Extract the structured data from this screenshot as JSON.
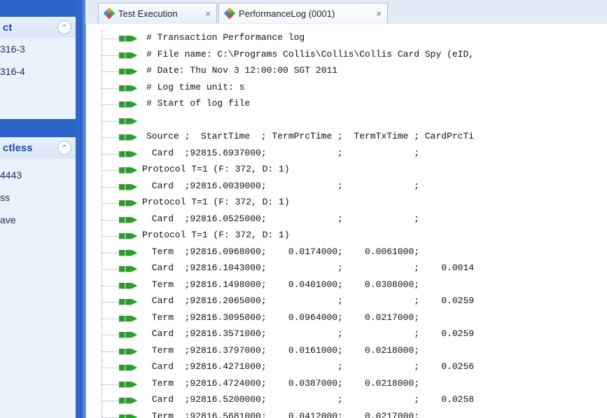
{
  "sidebar": {
    "panel1": {
      "title": "ct",
      "items": [
        "316-3",
        "316-4"
      ]
    },
    "panel2": {
      "title": "ctless",
      "items": [
        "4443",
        "ss",
        "ave"
      ]
    },
    "collapse_glyph": "⌃"
  },
  "tabs": [
    {
      "label": "Test Execution",
      "close": "×"
    },
    {
      "label": "PerformanceLog (0001)",
      "close": "×"
    }
  ],
  "colors": {
    "accent": "#1e5fc4",
    "arrow": "#2a9a2a"
  },
  "log": {
    "arrow_glyph": "■■▶",
    "lines": [
      "# Transaction Performance log",
      "# File name: C:\\Programs Collis\\Collis\\Collis Card Spy (eID,",
      "# Date: Thu Nov 3 12:00:00 SGT 2011",
      "# Log time unit: s",
      "# Start of log file",
      "",
      "Source ;  StartTime  ; TermPrcTime ;  TermTxTime ; CardPrcTi",
      " Card  ;92815.6937000;             ;             ;",
      "Protocol T=1 (F: 372, D: 1)",
      " Card  ;92816.0039000;             ;             ;",
      "Protocol T=1 (F: 372, D: 1)",
      " Card  ;92816.0525000;             ;             ;",
      "Protocol T=1 (F: 372, D: 1)",
      " Term  ;92816.0968000;    0.0174000;    0.0061000;",
      " Card  ;92816.1043000;             ;             ;    0.0014",
      " Term  ;92816.1498000;    0.0401000;    0.0308000;",
      " Card  ;92816.2065000;             ;             ;    0.0259",
      " Term  ;92816.3095000;    0.0964000;    0.0217000;",
      " Card  ;92816.3571000;             ;             ;    0.0259",
      " Term  ;92816.3797000;    0.0161000;    0.0218000;",
      " Card  ;92816.4271000;             ;             ;    0.0256",
      " Term  ;92816.4724000;    0.0387000;    0.0218000;",
      " Card  ;92816.5200000;             ;             ;    0.0258",
      " Term  ;92816.5681000;    0.0412000;    0.0217000;"
    ]
  }
}
